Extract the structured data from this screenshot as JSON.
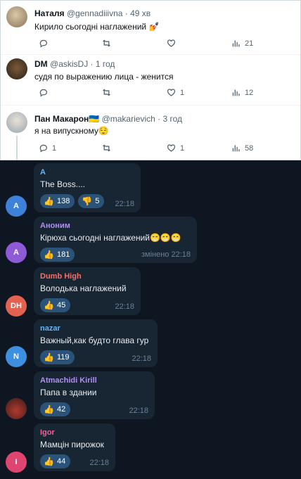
{
  "tweets": [
    {
      "name": "Наталя",
      "handle": "@gennadiiivna",
      "time": "· 49 хв",
      "text": "Кирило сьогодні наглажений 💅",
      "likes": "",
      "views": "21"
    },
    {
      "name": "DM",
      "handle": "@askisDJ",
      "time": "· 1 год",
      "text": "судя по выражению лица - женится",
      "likes": "1",
      "views": "12"
    },
    {
      "name": "Пан Макарон🇺🇦",
      "handle": "@makarievich",
      "time": "· 3 год",
      "text": "я на випускному😌",
      "replies": "1",
      "likes": "1",
      "views": "58"
    }
  ],
  "messages": [
    {
      "avatar_letter": "A",
      "avatar_color": "#3d82d8",
      "sender": "A",
      "sender_color": "#64b5f6",
      "text": "The Boss....",
      "reactions": [
        {
          "emoji": "👍",
          "count": "138"
        },
        {
          "emoji": "👎",
          "count": "5"
        }
      ],
      "time": "22:18"
    },
    {
      "avatar_letter": "A",
      "avatar_color": "#8e5ad6",
      "sender": "Аноним",
      "sender_color": "#b38ef5",
      "text": "Кірюха сьогодні наглажений😁😁😁",
      "reactions": [
        {
          "emoji": "👍",
          "count": "181"
        }
      ],
      "time": "змінено 22:18"
    },
    {
      "avatar_letter": "DH",
      "avatar_color": "#e2624f",
      "sender": "Dumb High",
      "sender_color": "#f2716b",
      "text": "Володька наглажений",
      "reactions": [
        {
          "emoji": "👍",
          "count": "45"
        }
      ],
      "time": "22:18"
    },
    {
      "avatar_letter": "N",
      "avatar_color": "#3d8fe0",
      "sender": "nazar",
      "sender_color": "#64b5f6",
      "text": "Важный,как будто глава гур",
      "reactions": [
        {
          "emoji": "👍",
          "count": "119"
        }
      ],
      "time": "22:18"
    },
    {
      "avatar_letter": "",
      "avatar_color": "#5a2a2a",
      "sender": "Atmachidi Kirill",
      "sender_color": "#b38ef5",
      "text": "Папа в здании",
      "reactions": [
        {
          "emoji": "👍",
          "count": "42"
        }
      ],
      "time": "22:18"
    },
    {
      "avatar_letter": "I",
      "avatar_color": "#e0456f",
      "sender": "Igor",
      "sender_color": "#f06292",
      "text": "Мамцін пирожок",
      "reactions": [
        {
          "emoji": "👍",
          "count": "44"
        }
      ],
      "time": "22:18"
    }
  ]
}
